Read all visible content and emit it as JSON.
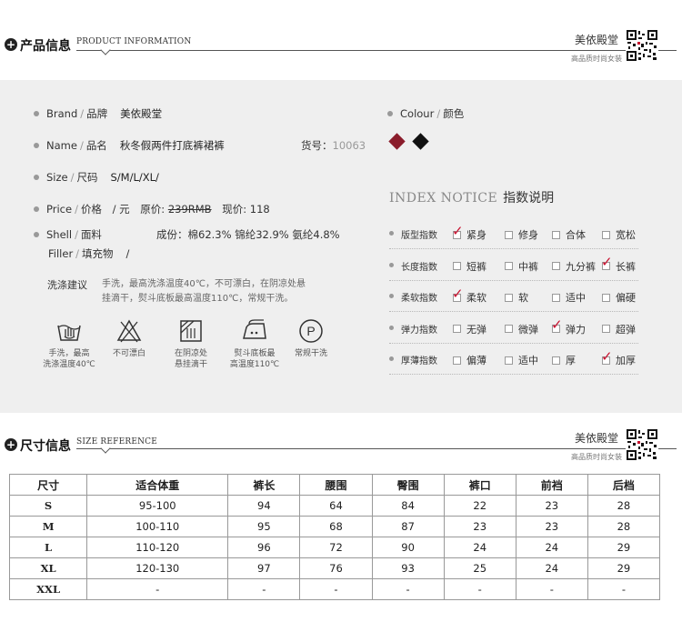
{
  "product_section": {
    "title_cn": "产品信息",
    "title_en": "PRODUCT INFORMATION",
    "brand": "美依殿堂",
    "brand_sub": "高品质时尚女装"
  },
  "info": {
    "brand": {
      "en": "Brand",
      "cn": "品牌",
      "value": "美依殿堂"
    },
    "name": {
      "en": "Name",
      "cn": "品名",
      "value": "秋冬假两件打底裤裙裤"
    },
    "sku": {
      "label": "货号：",
      "value": "10063"
    },
    "size": {
      "en": "Size",
      "cn": "尺码",
      "value": "S/M/L/XL/"
    },
    "price": {
      "en": "Price",
      "cn": "价格",
      "unit": "/ 元",
      "orig_label": "原价:",
      "orig_value": "239RMB",
      "now_label": "现价:",
      "now_value": "118"
    },
    "shell": {
      "en": "Shell",
      "cn": "面料",
      "comp_label": "成份：",
      "comp_value": "棉62.3%  锦纶32.9%  氨纶4.8%"
    },
    "filler": {
      "en": "Filler",
      "cn": "填充物",
      "value": "/"
    },
    "colour": {
      "en": "Colour",
      "cn": "颜色",
      "swatches": [
        "#8a1c2b",
        "#111111"
      ]
    }
  },
  "index_notice": {
    "title_en": "INDEX NOTICE",
    "title_cn": "指数说明",
    "rows": [
      {
        "label": "版型指数",
        "options": [
          "紧身",
          "修身",
          "合体",
          "宽松"
        ],
        "checked": 0
      },
      {
        "label": "长度指数",
        "options": [
          "短裤",
          "中裤",
          "九分裤",
          "长裤"
        ],
        "checked": 3
      },
      {
        "label": "柔软指数",
        "options": [
          "柔软",
          "软",
          "适中",
          "偏硬"
        ],
        "checked": 0
      },
      {
        "label": "弹力指数",
        "options": [
          "无弹",
          "微弹",
          "弹力",
          "超弹"
        ],
        "checked": 2
      },
      {
        "label": "厚薄指数",
        "options": [
          "偏薄",
          "适中",
          "厚",
          "加厚"
        ],
        "checked": 3
      }
    ]
  },
  "wash": {
    "title": "洗涤建议",
    "line1": "手洗，最高洗涤温度40℃，不可漂白，在阴凉处悬",
    "line2": "挂滴干，熨斗底板最高温度110℃，常规干洗。",
    "icons": [
      {
        "icon": "hand-wash-icon",
        "line1": "手洗，最高",
        "line2": "洗涤温度40℃"
      },
      {
        "icon": "no-bleach-icon",
        "line1": "不可漂白",
        "line2": ""
      },
      {
        "icon": "line-dry-shade-icon",
        "line1": "在阴凉处",
        "line2": "悬挂滴干"
      },
      {
        "icon": "iron-icon",
        "line1": "熨斗底板最",
        "line2": "高温度110℃"
      },
      {
        "icon": "dry-clean-icon",
        "line1": "常规干洗",
        "line2": ""
      }
    ],
    "dry_clean_letter": "P"
  },
  "size_section": {
    "title_cn": "尺寸信息",
    "title_en": "SIZE REFERENCE",
    "brand": "美依殿堂",
    "brand_sub": "高品质时尚女装"
  },
  "size_table": {
    "headers": [
      "尺寸",
      "适合体重",
      "裤长",
      "腰围",
      "臀围",
      "裤口",
      "前裆",
      "后档"
    ],
    "rows": [
      [
        "S",
        "95-100",
        "94",
        "64",
        "84",
        "22",
        "23",
        "28"
      ],
      [
        "M",
        "100-110",
        "95",
        "68",
        "87",
        "23",
        "23",
        "28"
      ],
      [
        "L",
        "110-120",
        "96",
        "72",
        "90",
        "24",
        "24",
        "29"
      ],
      [
        "XL",
        "120-130",
        "97",
        "76",
        "93",
        "25",
        "24",
        "29"
      ],
      [
        "XXL",
        "-",
        "-",
        "-",
        "-",
        "-",
        "-",
        "-"
      ]
    ]
  }
}
